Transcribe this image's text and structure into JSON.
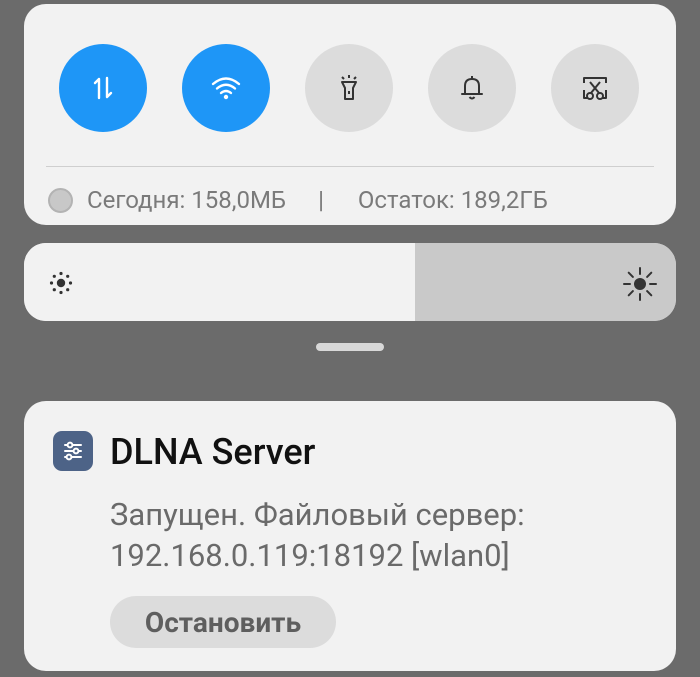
{
  "quick_settings": {
    "toggles": [
      {
        "name": "mobile-data",
        "icon": "data-arrows-icon",
        "on": true
      },
      {
        "name": "wifi",
        "icon": "wifi-icon",
        "on": true
      },
      {
        "name": "flashlight",
        "icon": "flashlight-icon",
        "on": false
      },
      {
        "name": "sound",
        "icon": "bell-icon",
        "on": false
      },
      {
        "name": "screenshot",
        "icon": "scissors-icon",
        "on": false
      }
    ],
    "usage_today": "Сегодня: 158,0МБ",
    "separator": "|",
    "usage_remaining": "Остаток: 189,2ГБ"
  },
  "brightness": {
    "level_percent": 60
  },
  "notification": {
    "app_name": "DLNA Server",
    "message_line1": "Запущен. Файловый сервер:",
    "message_line2": "192.168.0.119:18192 [wlan0]",
    "action_label": "Остановить"
  },
  "colors": {
    "accent": "#1e96f7",
    "panel": "#f2f2f2",
    "background": "#6b6b6b",
    "app_icon": "#4d6387"
  }
}
